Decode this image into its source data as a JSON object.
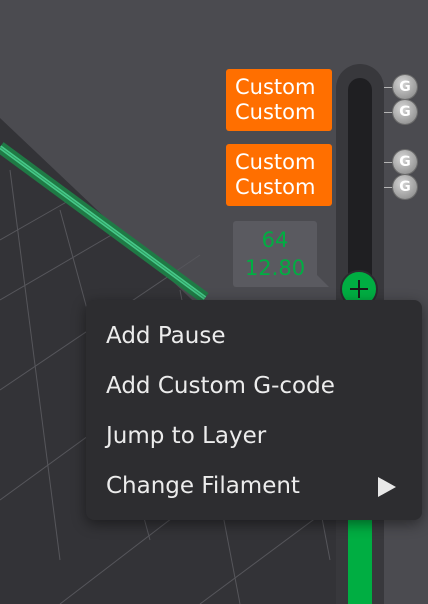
{
  "layer_slider": {
    "current_layer": "64",
    "current_height": "12.80"
  },
  "gcode_markers": [
    {
      "line1": "Custom",
      "line2": "Custom",
      "icons": [
        "G",
        "G"
      ]
    },
    {
      "line1": "Custom",
      "line2": "Custom",
      "icons": [
        "G",
        "G"
      ]
    }
  ],
  "context_menu": {
    "items": [
      {
        "label": "Add Pause"
      },
      {
        "label": "Add Custom G-code"
      },
      {
        "label": "Jump to Layer"
      },
      {
        "label": "Change Filament",
        "has_submenu": true
      }
    ]
  },
  "colors": {
    "accent_green": "#00ae42",
    "marker_orange": "#ff6f00",
    "menu_bg": "#2d2d30",
    "canvas_bg": "#4b4b50"
  }
}
